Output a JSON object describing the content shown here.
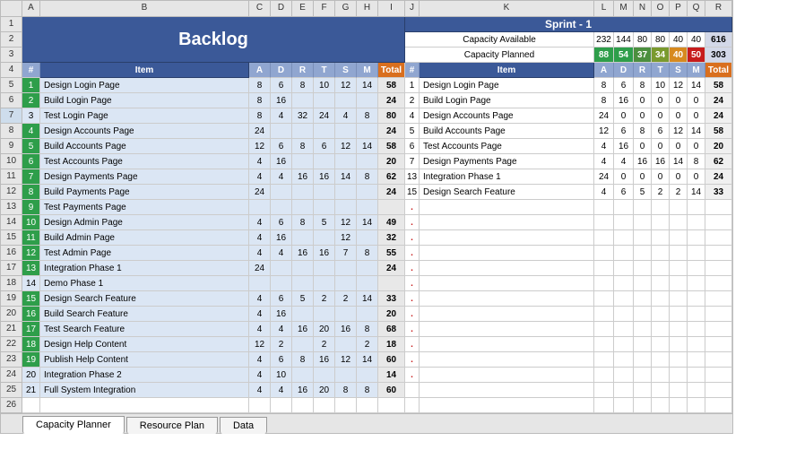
{
  "columns": [
    "",
    "A",
    "B",
    "C",
    "D",
    "E",
    "F",
    "G",
    "H",
    "I",
    "J",
    "K",
    "L",
    "M",
    "N",
    "O",
    "P",
    "Q",
    "R"
  ],
  "rowNumbers": [
    "1",
    "2",
    "3",
    "4",
    "5",
    "6",
    "7",
    "8",
    "9",
    "10",
    "11",
    "12",
    "13",
    "14",
    "15",
    "16",
    "17",
    "18",
    "19",
    "20",
    "21",
    "22",
    "23",
    "24",
    "25",
    "26"
  ],
  "title_backlog": "Backlog",
  "title_sprint": "Sprint - 1",
  "cap_available_label": "Capacity Available",
  "cap_planned_label": "Capacity Planned",
  "cap_available": {
    "L": "232",
    "M": "144",
    "N": "80",
    "O": "80",
    "P": "40",
    "Q": "40",
    "R": "616"
  },
  "cap_planned": {
    "L": "88",
    "M": "54",
    "N": "37",
    "O": "34",
    "P": "40",
    "Q": "50",
    "R": "303"
  },
  "col_headers_labels": {
    "A": "#",
    "B": "Item",
    "C": "A",
    "D": "D",
    "E": "R",
    "F": "T",
    "G": "S",
    "H": "M",
    "I": "Total",
    "J": "#",
    "K": "Item",
    "L": "A",
    "M": "D",
    "N": "R",
    "O": "T",
    "P": "S",
    "Q": "M",
    "R": "Total"
  },
  "backlog": [
    {
      "n": "1",
      "g": true,
      "item": "Design Login Page",
      "A": "8",
      "D": "6",
      "R": "8",
      "T": "10",
      "S": "12",
      "M": "14",
      "Tot": "58"
    },
    {
      "n": "2",
      "g": true,
      "item": "Build Login Page",
      "A": "8",
      "D": "16",
      "R": "",
      "T": "",
      "S": "",
      "M": "",
      "Tot": "24"
    },
    {
      "n": "3",
      "g": false,
      "item": "Test Login Page",
      "A": "8",
      "D": "4",
      "R": "32",
      "T": "24",
      "S": "4",
      "M": "8",
      "Tot": "80"
    },
    {
      "n": "4",
      "g": true,
      "item": "Design Accounts Page",
      "A": "24",
      "D": "",
      "R": "",
      "T": "",
      "S": "",
      "M": "",
      "Tot": "24"
    },
    {
      "n": "5",
      "g": true,
      "item": "Build Accounts Page",
      "A": "12",
      "D": "6",
      "R": "8",
      "T": "6",
      "S": "12",
      "M": "14",
      "Tot": "58"
    },
    {
      "n": "6",
      "g": true,
      "item": "Test Accounts Page",
      "A": "4",
      "D": "16",
      "R": "",
      "T": "",
      "S": "",
      "M": "",
      "Tot": "20"
    },
    {
      "n": "7",
      "g": true,
      "item": "Design Payments Page",
      "A": "4",
      "D": "4",
      "R": "16",
      "T": "16",
      "S": "14",
      "M": "8",
      "Tot": "62"
    },
    {
      "n": "8",
      "g": true,
      "item": "Build Payments Page",
      "A": "24",
      "D": "",
      "R": "",
      "T": "",
      "S": "",
      "M": "",
      "Tot": "24"
    },
    {
      "n": "9",
      "g": true,
      "item": "Test Payments Page",
      "A": "",
      "D": "",
      "R": "",
      "T": "",
      "S": "",
      "M": "",
      "Tot": ""
    },
    {
      "n": "10",
      "g": true,
      "item": "Design Admin Page",
      "A": "4",
      "D": "6",
      "R": "8",
      "T": "5",
      "S": "12",
      "M": "14",
      "Tot": "49"
    },
    {
      "n": "11",
      "g": true,
      "item": "Build Admin Page",
      "A": "4",
      "D": "16",
      "R": "",
      "T": "",
      "S": "12",
      "M": "",
      "Tot": "32"
    },
    {
      "n": "12",
      "g": true,
      "item": "Test Admin Page",
      "A": "4",
      "D": "4",
      "R": "16",
      "T": "16",
      "S": "7",
      "M": "8",
      "Tot": "55"
    },
    {
      "n": "13",
      "g": true,
      "item": "Integration Phase 1",
      "A": "24",
      "D": "",
      "R": "",
      "T": "",
      "S": "",
      "M": "",
      "Tot": "24"
    },
    {
      "n": "14",
      "g": false,
      "item": "Demo Phase 1",
      "A": "",
      "D": "",
      "R": "",
      "T": "",
      "S": "",
      "M": "",
      "Tot": ""
    },
    {
      "n": "15",
      "g": true,
      "item": "Design Search Feature",
      "A": "4",
      "D": "6",
      "R": "5",
      "T": "2",
      "S": "2",
      "M": "14",
      "Tot": "33"
    },
    {
      "n": "16",
      "g": true,
      "item": "Build Search Feature",
      "A": "4",
      "D": "16",
      "R": "",
      "T": "",
      "S": "",
      "M": "",
      "Tot": "20"
    },
    {
      "n": "17",
      "g": true,
      "item": "Test Search Feature",
      "A": "4",
      "D": "4",
      "R": "16",
      "T": "20",
      "S": "16",
      "M": "8",
      "Tot": "68"
    },
    {
      "n": "18",
      "g": true,
      "item": "Design Help Content",
      "A": "12",
      "D": "2",
      "R": "",
      "T": "2",
      "S": "",
      "M": "2",
      "Tot": "18"
    },
    {
      "n": "19",
      "g": true,
      "item": "Publish Help Content",
      "A": "4",
      "D": "6",
      "R": "8",
      "T": "16",
      "S": "12",
      "M": "14",
      "Tot": "60"
    },
    {
      "n": "20",
      "g": false,
      "item": "Integration Phase 2",
      "A": "4",
      "D": "10",
      "R": "",
      "T": "",
      "S": "",
      "M": "",
      "Tot": "14"
    },
    {
      "n": "21",
      "g": false,
      "item": "Full System Integration",
      "A": "4",
      "D": "4",
      "R": "16",
      "T": "20",
      "S": "8",
      "M": "8",
      "Tot": "60"
    }
  ],
  "sprint": [
    {
      "n": "1",
      "item": "Design Login Page",
      "L": "8",
      "M": "6",
      "N": "8",
      "O": "10",
      "P": "12",
      "Q": "14",
      "Tot": "58"
    },
    {
      "n": "2",
      "item": "Build Login Page",
      "L": "8",
      "M": "16",
      "N": "0",
      "O": "0",
      "P": "0",
      "Q": "0",
      "Tot": "24"
    },
    {
      "n": "4",
      "item": "Design Accounts Page",
      "L": "24",
      "M": "0",
      "N": "0",
      "O": "0",
      "P": "0",
      "Q": "0",
      "Tot": "24"
    },
    {
      "n": "5",
      "item": "Build Accounts Page",
      "L": "12",
      "M": "6",
      "N": "8",
      "O": "6",
      "P": "12",
      "Q": "14",
      "Tot": "58"
    },
    {
      "n": "6",
      "item": "Test Accounts Page",
      "L": "4",
      "M": "16",
      "N": "0",
      "O": "0",
      "P": "0",
      "Q": "0",
      "Tot": "20"
    },
    {
      "n": "7",
      "item": "Design Payments Page",
      "L": "4",
      "M": "4",
      "N": "16",
      "O": "16",
      "P": "14",
      "Q": "8",
      "Tot": "62"
    },
    {
      "n": "13",
      "item": "Integration Phase 1",
      "L": "24",
      "M": "0",
      "N": "0",
      "O": "0",
      "P": "0",
      "Q": "0",
      "Tot": "24"
    },
    {
      "n": "15",
      "item": "Design Search Feature",
      "L": "4",
      "M": "6",
      "N": "5",
      "O": "2",
      "P": "2",
      "Q": "14",
      "Tot": "33"
    }
  ],
  "dots_after_sprint": 12,
  "tabs": [
    {
      "label": "Capacity Planner",
      "active": true
    },
    {
      "label": "Resource Plan",
      "active": false
    },
    {
      "label": "Data",
      "active": false
    }
  ],
  "dot_char": "."
}
